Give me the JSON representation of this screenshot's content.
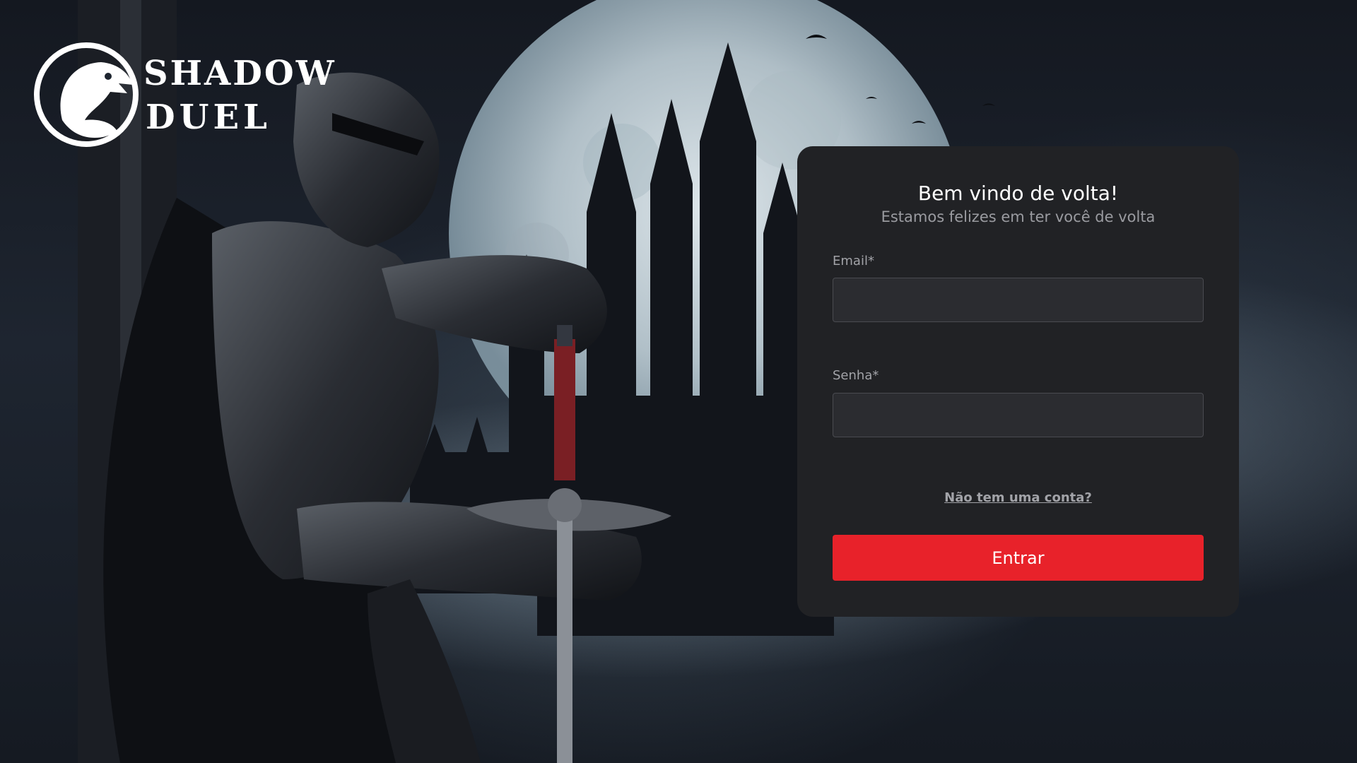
{
  "brand": {
    "line1": "SHADOW",
    "line2": "DUEL",
    "logo_icon": "dragon-emblem-icon"
  },
  "background": {
    "description_icon": "knight-castle-moon-illustration"
  },
  "login": {
    "title": "Bem vindo de volta!",
    "subtitle": "Estamos felizes em ter você de volta",
    "email_label": "Email*",
    "email_value": "",
    "password_label": "Senha*",
    "password_value": "",
    "signup_link": "Não tem uma conta?",
    "submit_label": "Entrar"
  },
  "colors": {
    "card_background": "#212225",
    "input_background": "#2b2c30",
    "accent": "#e8222a",
    "muted_text": "#a2a3a8"
  }
}
